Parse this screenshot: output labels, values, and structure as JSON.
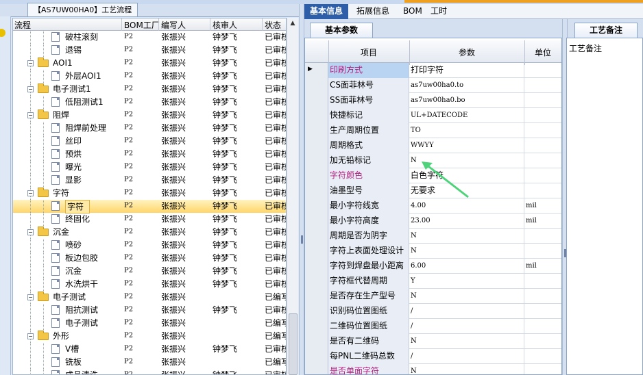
{
  "left_tab": "【AS7UW00HA0】工艺流程",
  "left_columns": [
    "流程",
    "BOM工厂",
    "编写人",
    "核审人",
    "状态"
  ],
  "tree_rows": [
    {
      "level": 2,
      "kind": "doc",
      "name": "破柱滚刻",
      "bom": "P2",
      "writer": "张振兴",
      "checker": "钟梦飞",
      "status": "已审核"
    },
    {
      "level": 2,
      "kind": "doc",
      "name": "退锡",
      "bom": "P2",
      "writer": "张振兴",
      "checker": "钟梦飞",
      "status": "已审核"
    },
    {
      "level": 1,
      "kind": "folder",
      "name": "AOI1",
      "bom": "P2",
      "writer": "张振兴",
      "checker": "钟梦飞",
      "status": "已审核"
    },
    {
      "level": 2,
      "kind": "doc",
      "name": "外层AOI1",
      "bom": "P2",
      "writer": "张振兴",
      "checker": "钟梦飞",
      "status": "已审核"
    },
    {
      "level": 1,
      "kind": "folder",
      "name": "电子测试1",
      "bom": "P2",
      "writer": "张振兴",
      "checker": "钟梦飞",
      "status": "已审核"
    },
    {
      "level": 2,
      "kind": "doc",
      "name": "低阻测试1",
      "bom": "P2",
      "writer": "张振兴",
      "checker": "钟梦飞",
      "status": "已审核"
    },
    {
      "level": 1,
      "kind": "folder",
      "name": "阻焊",
      "bom": "P2",
      "writer": "张振兴",
      "checker": "钟梦飞",
      "status": "已审核"
    },
    {
      "level": 2,
      "kind": "doc",
      "name": "阻焊前处理",
      "bom": "P2",
      "writer": "张振兴",
      "checker": "钟梦飞",
      "status": "已审核"
    },
    {
      "level": 2,
      "kind": "doc",
      "name": "丝印",
      "bom": "P2",
      "writer": "张振兴",
      "checker": "钟梦飞",
      "status": "已审核"
    },
    {
      "level": 2,
      "kind": "doc",
      "name": "预烘",
      "bom": "P2",
      "writer": "张振兴",
      "checker": "钟梦飞",
      "status": "已审核"
    },
    {
      "level": 2,
      "kind": "doc",
      "name": "曝光",
      "bom": "P2",
      "writer": "张振兴",
      "checker": "钟梦飞",
      "status": "已审核"
    },
    {
      "level": 2,
      "kind": "doc",
      "name": "显影",
      "bom": "P2",
      "writer": "张振兴",
      "checker": "钟梦飞",
      "status": "已审核"
    },
    {
      "level": 1,
      "kind": "folder",
      "name": "字符",
      "bom": "P2",
      "writer": "张振兴",
      "checker": "钟梦飞",
      "status": "已审核"
    },
    {
      "level": 2,
      "kind": "doc",
      "name": "字符",
      "bom": "P2",
      "writer": "张振兴",
      "checker": "钟梦飞",
      "status": "已审核",
      "selected": true
    },
    {
      "level": 2,
      "kind": "doc",
      "name": "终固化",
      "bom": "P2",
      "writer": "张振兴",
      "checker": "钟梦飞",
      "status": "已审核"
    },
    {
      "level": 1,
      "kind": "folder",
      "name": "沉金",
      "bom": "P2",
      "writer": "张振兴",
      "checker": "钟梦飞",
      "status": "已审核"
    },
    {
      "level": 2,
      "kind": "doc",
      "name": "喷砂",
      "bom": "P2",
      "writer": "张振兴",
      "checker": "钟梦飞",
      "status": "已审核"
    },
    {
      "level": 2,
      "kind": "doc",
      "name": "板边包胶",
      "bom": "P2",
      "writer": "张振兴",
      "checker": "钟梦飞",
      "status": "已审核"
    },
    {
      "level": 2,
      "kind": "doc",
      "name": "沉金",
      "bom": "P2",
      "writer": "张振兴",
      "checker": "钟梦飞",
      "status": "已审核"
    },
    {
      "level": 2,
      "kind": "doc",
      "name": "水洗烘干",
      "bom": "P2",
      "writer": "张振兴",
      "checker": "钟梦飞",
      "status": "已审核"
    },
    {
      "level": 1,
      "kind": "folder",
      "name": "电子测试",
      "bom": "P2",
      "writer": "张振兴",
      "checker": "",
      "status": "已编写"
    },
    {
      "level": 2,
      "kind": "doc",
      "name": "阻抗测试",
      "bom": "P2",
      "writer": "张振兴",
      "checker": "钟梦飞",
      "status": "已审核"
    },
    {
      "level": 2,
      "kind": "doc",
      "name": "电子测试",
      "bom": "P2",
      "writer": "张振兴",
      "checker": "",
      "status": "已编写"
    },
    {
      "level": 1,
      "kind": "folder",
      "name": "外形",
      "bom": "P2",
      "writer": "张振兴",
      "checker": "",
      "status": "已编写"
    },
    {
      "level": 2,
      "kind": "doc",
      "name": "V槽",
      "bom": "P2",
      "writer": "张振兴",
      "checker": "钟梦飞",
      "status": "已审核"
    },
    {
      "level": 2,
      "kind": "doc",
      "name": "铣板",
      "bom": "P2",
      "writer": "张振兴",
      "checker": "",
      "status": "已编写"
    },
    {
      "level": 2,
      "kind": "doc",
      "name": "成品清洗",
      "bom": "P2",
      "writer": "张振兴",
      "checker": "钟梦飞",
      "status": "已审核"
    }
  ],
  "right_tabs": [
    "基本信息",
    "拓展信息",
    "BOM",
    "工时"
  ],
  "sub_tab": "基本参数",
  "notes_tab": "工艺备注",
  "notes_label": "工艺备注",
  "param_columns": [
    "项目",
    "参数",
    "单位"
  ],
  "params": [
    {
      "k": "印刷方式",
      "v": "打印字符",
      "u": "",
      "pink": true,
      "current": true
    },
    {
      "k": "CS面菲林号",
      "v": "as7uw00ha0.to",
      "u": "",
      "serif": true
    },
    {
      "k": "SS面菲林号",
      "v": "as7uw00ha0.bo",
      "u": "",
      "serif": true
    },
    {
      "k": "快捷标记",
      "v": "UL+DATECODE",
      "u": "",
      "serif": true
    },
    {
      "k": "生产周期位置",
      "v": "TO",
      "u": "",
      "serif": true
    },
    {
      "k": "周期格式",
      "v": "WWYY",
      "u": "",
      "serif": true
    },
    {
      "k": "加无铅标记",
      "v": "N",
      "u": "",
      "serif": true
    },
    {
      "k": "字符颜色",
      "v": "白色字符",
      "u": "",
      "pink": true
    },
    {
      "k": "油墨型号",
      "v": "无要求",
      "u": ""
    },
    {
      "k": "最小字符线宽",
      "v": "4.00",
      "u": "mil",
      "serif": true
    },
    {
      "k": "最小字符高度",
      "v": "23.00",
      "u": "mil",
      "serif": true
    },
    {
      "k": "周期是否为阴字",
      "v": "N",
      "u": "",
      "serif": true
    },
    {
      "k": "字符上表面处理设计",
      "v": "N",
      "u": "",
      "serif": true
    },
    {
      "k": "字符到焊盘最小距离",
      "v": "6.00",
      "u": "mil",
      "serif": true
    },
    {
      "k": "字符框代替周期",
      "v": "Y",
      "u": "",
      "serif": true
    },
    {
      "k": "是否存在生产型号",
      "v": "N",
      "u": "",
      "serif": true
    },
    {
      "k": "识别码位置图纸",
      "v": "/",
      "u": "",
      "serif": true
    },
    {
      "k": "二维码位置图纸",
      "v": "/",
      "u": "",
      "serif": true
    },
    {
      "k": "是否有二维码",
      "v": "N",
      "u": "",
      "serif": true
    },
    {
      "k": "每PNL二维码总数",
      "v": "/",
      "u": "",
      "serif": true
    },
    {
      "k": "是否单面字符",
      "v": "N",
      "u": "",
      "pink": true,
      "serif": true
    }
  ]
}
